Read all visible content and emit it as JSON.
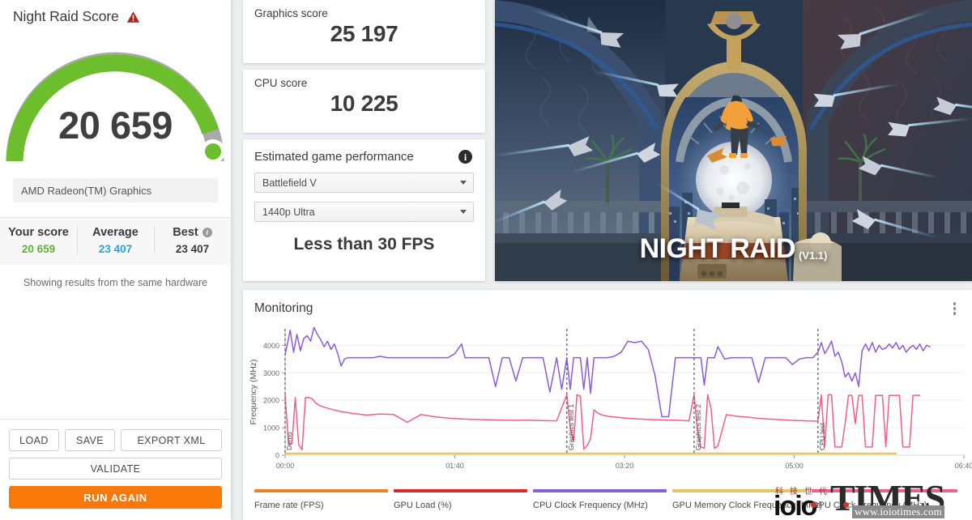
{
  "left_panel": {
    "title": "Night Raid Score",
    "warning_icon": "warning-triangle-icon",
    "score": "20 659",
    "gauge": {
      "percent": 88,
      "arc_color": "#6cbe2c",
      "track_color": "#a9a9a9"
    },
    "hardware": "AMD Radeon(TM) Graphics",
    "comparison": [
      {
        "label": "Your score",
        "value": "20 659",
        "color": "#5cb531",
        "has_info": false
      },
      {
        "label": "Average",
        "value": "23 407",
        "color": "#2aa3e0",
        "has_info": false
      },
      {
        "label": "Best",
        "value": "23 407",
        "color": "#3b3b3b",
        "has_info": true
      }
    ],
    "note": "Showing results from the same hardware",
    "buttons": {
      "load": "LOAD",
      "save": "SAVE",
      "export_xml": "EXPORT XML",
      "validate": "VALIDATE",
      "run_again": "RUN AGAIN",
      "run_again_color": "#f87909"
    }
  },
  "cards": {
    "graphics": {
      "label": "Graphics score",
      "value": "25 197"
    },
    "cpu": {
      "label": "CPU score",
      "value": "10 225"
    },
    "estimated": {
      "title": "Estimated game performance",
      "info_icon": "info-icon",
      "game": "Battlefield V",
      "preset": "1440p Ultra",
      "result": "Less than 30 FPS"
    }
  },
  "hero": {
    "title": "NIGHT RAID",
    "version": "(V1.1)"
  },
  "monitoring": {
    "title": "Monitoring",
    "menu_icon": "kebab-menu-icon",
    "legend": [
      {
        "label": "Frame rate (FPS)",
        "color": "#f08022"
      },
      {
        "label": "GPU Load (%)",
        "color": "#d62b28"
      },
      {
        "label": "CPU Clock Frequency (MHz)",
        "color": "#8b5cd6"
      },
      {
        "label": "GPU Memory Clock Frequency (MHz)",
        "color": "#e3c567"
      },
      {
        "label": "GPU Clock Frequency (MHz)",
        "color": "#ef5f8c"
      }
    ],
    "markers": [
      {
        "label": "Demo",
        "t": 0
      },
      {
        "label": "Graphics test 1",
        "t": 166
      },
      {
        "label": "Graphics test 2",
        "t": 241
      },
      {
        "label": "CPU test",
        "t": 314
      }
    ]
  },
  "chart_data": {
    "type": "line",
    "title": "Monitoring",
    "xlabel": "",
    "ylabel": "Frequency (MHz)",
    "xlim": [
      0,
      400
    ],
    "ylim": [
      0,
      4600
    ],
    "yticks": [
      0,
      1000,
      2000,
      3000,
      4000
    ],
    "xticks": [
      0,
      100,
      200,
      300,
      400
    ],
    "xticklabels": [
      "00:00",
      "01:40",
      "03:20",
      "05:00",
      "06:40"
    ],
    "grid": true,
    "legend_position": "bottom",
    "series": [
      {
        "name": "CPU Clock Frequency (MHz)",
        "color": "#8b5cd6",
        "x": [
          0,
          3,
          5,
          7,
          9,
          11,
          13,
          15,
          17,
          19,
          21,
          23,
          25,
          27,
          29,
          31,
          33,
          35,
          37,
          40,
          44,
          48,
          52,
          56,
          60,
          64,
          68,
          72,
          76,
          80,
          84,
          88,
          92,
          96,
          100,
          104,
          106,
          108,
          112,
          116,
          120,
          124,
          128,
          130,
          132,
          136,
          140,
          144,
          148,
          152,
          156,
          160,
          163,
          166,
          168,
          170,
          172,
          174,
          176,
          178,
          180,
          182,
          184,
          186,
          188,
          190,
          194,
          198,
          202,
          206,
          210,
          214,
          218,
          222,
          226,
          230,
          234,
          238,
          241,
          243,
          245,
          247,
          249,
          251,
          253,
          255,
          259,
          263,
          267,
          271,
          275,
          279,
          283,
          287,
          291,
          295,
          299,
          303,
          307,
          311,
          314,
          316,
          318,
          320,
          322,
          324,
          326,
          328,
          330,
          332,
          334,
          336,
          338,
          340,
          342,
          344,
          346,
          348,
          350,
          352,
          354,
          356,
          358,
          360,
          362,
          364,
          366,
          368,
          370,
          372,
          374,
          376,
          378,
          380
        ],
        "y": [
          3650,
          4550,
          3750,
          4400,
          3800,
          4250,
          4350,
          4150,
          4650,
          4400,
          4200,
          3950,
          4150,
          3850,
          4050,
          3700,
          3250,
          3500,
          3550,
          3550,
          3550,
          3550,
          3550,
          3600,
          3550,
          3550,
          3550,
          3550,
          3550,
          3550,
          3550,
          3550,
          3550,
          3550,
          3700,
          4050,
          3550,
          3550,
          3550,
          3550,
          3550,
          2500,
          3550,
          3550,
          3550,
          2700,
          3550,
          3550,
          3550,
          3550,
          2300,
          3550,
          2400,
          3550,
          2400,
          3550,
          3550,
          3550,
          2400,
          3550,
          2250,
          3550,
          3550,
          3550,
          3550,
          3550,
          3600,
          3750,
          4150,
          4100,
          4150,
          3850,
          2900,
          1400,
          1400,
          3550,
          3550,
          3550,
          3550,
          3550,
          3550,
          2550,
          3550,
          3550,
          3550,
          3950,
          3500,
          3550,
          3550,
          3550,
          3550,
          2650,
          3550,
          3550,
          3550,
          3550,
          3300,
          3500,
          3550,
          3550,
          3750,
          4100,
          3700,
          3900,
          4150,
          3600,
          3750,
          3400,
          2850,
          3000,
          2700,
          3000,
          2500,
          3800,
          4050,
          3800,
          4100,
          3750,
          4000,
          3850,
          3900,
          4050,
          3900,
          4100,
          3850,
          4000,
          3750,
          3900,
          4000,
          3850,
          4050,
          3800,
          4000,
          3950
        ]
      },
      {
        "name": "GPU Clock Frequency (MHz)",
        "color": "#ef5f8c",
        "x": [
          0,
          2,
          4,
          6,
          8,
          10,
          12,
          14,
          16,
          18,
          20,
          22,
          24,
          28,
          32,
          36,
          40,
          48,
          56,
          64,
          72,
          80,
          88,
          96,
          104,
          112,
          120,
          128,
          136,
          144,
          152,
          160,
          166,
          168,
          170,
          172,
          174,
          176,
          178,
          180,
          182,
          184,
          186,
          190,
          196,
          202,
          208,
          214,
          220,
          226,
          232,
          238,
          241,
          243,
          245,
          247,
          249,
          251,
          253,
          255,
          260,
          266,
          272,
          278,
          284,
          290,
          296,
          302,
          308,
          314,
          316,
          318,
          320,
          322,
          324,
          326,
          328,
          330,
          332,
          334,
          336,
          338,
          340,
          342,
          344,
          346,
          348,
          350,
          352,
          354,
          356,
          358,
          360,
          362,
          364,
          366,
          368,
          370,
          372,
          374,
          376
        ],
        "y": [
          2200,
          400,
          420,
          2100,
          380,
          200,
          2100,
          2100,
          2050,
          1900,
          1820,
          1770,
          1730,
          1660,
          1600,
          1560,
          1520,
          1460,
          1500,
          1480,
          1200,
          1480,
          1400,
          1350,
          1320,
          1300,
          1290,
          1280,
          1270,
          1270,
          1260,
          1250,
          2200,
          1000,
          500,
          2200,
          2150,
          220,
          350,
          600,
          1650,
          1550,
          1480,
          1420,
          1380,
          1340,
          1320,
          1300,
          1290,
          1280,
          1270,
          1250,
          2200,
          900,
          300,
          250,
          2200,
          1700,
          250,
          330,
          1480,
          1420,
          1390,
          1350,
          1320,
          1300,
          1280,
          1260,
          1250,
          1240,
          2200,
          300,
          2200,
          2200,
          300,
          300,
          300,
          1150,
          2180,
          2180,
          1150,
          2180,
          2180,
          300,
          300,
          300,
          2180,
          2180,
          2180,
          300,
          2180,
          2180,
          2180,
          2180,
          300,
          300,
          300,
          2180,
          2180,
          2180
        ]
      },
      {
        "name": "GPU Memory Clock Frequency (MHz)",
        "color": "#e3c567",
        "x": [
          0,
          360
        ],
        "y": [
          60,
          60
        ]
      },
      {
        "name": "Frame rate (FPS)",
        "color": "#f08022",
        "x": [],
        "y": []
      },
      {
        "name": "GPU Load (%)",
        "color": "#d62b28",
        "x": [],
        "y": []
      }
    ]
  },
  "watermark": {
    "times": "TIMES",
    "ioio": "ioio",
    "cn": "科技世代",
    "url": "www.ioiotimes.com"
  }
}
